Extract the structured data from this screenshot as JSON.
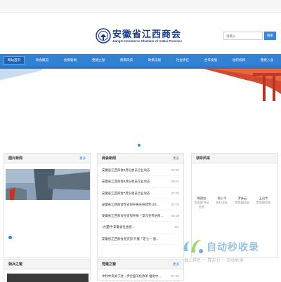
{
  "header": {
    "title_cn": "安徽省江西商会",
    "title_en": "JiangXi Commerce Chamber of AnHui Province",
    "search": {
      "placeholder": "请输入",
      "button": "搜索"
    }
  },
  "nav": [
    "网站首页",
    "商会概况",
    "会情要闻",
    "党建之窗",
    "骨雨风采",
    "政策法规",
    "社会责任",
    "合作发展",
    "组织机构",
    "我要入会"
  ],
  "panels": {
    "photo_news": {
      "title": "图片新闻",
      "more": "更多"
    },
    "chamber_news": {
      "title": "商会新闻",
      "more": "更多",
      "items": [
        {
          "text": "安徽省江西商会9月份会员企业动态",
          "date": "09-02"
        },
        {
          "text": "安徽省江西商会8月份会员企业动态",
          "date": "08-21"
        },
        {
          "text": "安徽省江西商会7月份会员企业动态",
          "date": "07-02"
        },
        {
          "text": "安徽省江西商会党支部开展庆祝建党103...",
          "date": "07-02"
        },
        {
          "text": "安徽省江西商会党支部开展「反诈宣传进商...",
          "date": "06-28"
        },
        {
          "text": "\"力量杯\"安徽省社会组...",
          "date": "05-"
        },
        {
          "text": "安徽省江西商会党支部 开展「定七一 质...",
          "date": ""
        }
      ]
    },
    "leaders": {
      "title": "领导风采",
      "people": [
        {
          "name": "熊建忠",
          "role": "党支部书记会长"
        },
        {
          "name": "陈小平",
          "role": "执行会长"
        },
        {
          "name": "罗赤云",
          "role": "常务副会长"
        },
        {
          "name": "王诏华",
          "role": "常务副会长"
        }
      ]
    },
    "heroes": {
      "title": "骑兵之窗"
    },
    "party": {
      "title": "党建之窗",
      "more": "更多",
      "items": [
        {
          "text": "中共中央关于进一步全面深化改革 推进中...",
          "date": "07-23"
        }
      ]
    }
  },
  "watermark": {
    "brand": "自动秒收录",
    "tagline": "做上排名 一 靠实力 一 自动收录"
  },
  "colors": {
    "primary": "#3381d3",
    "brand": "#1b3c8a",
    "accent": "#3a86d4"
  }
}
